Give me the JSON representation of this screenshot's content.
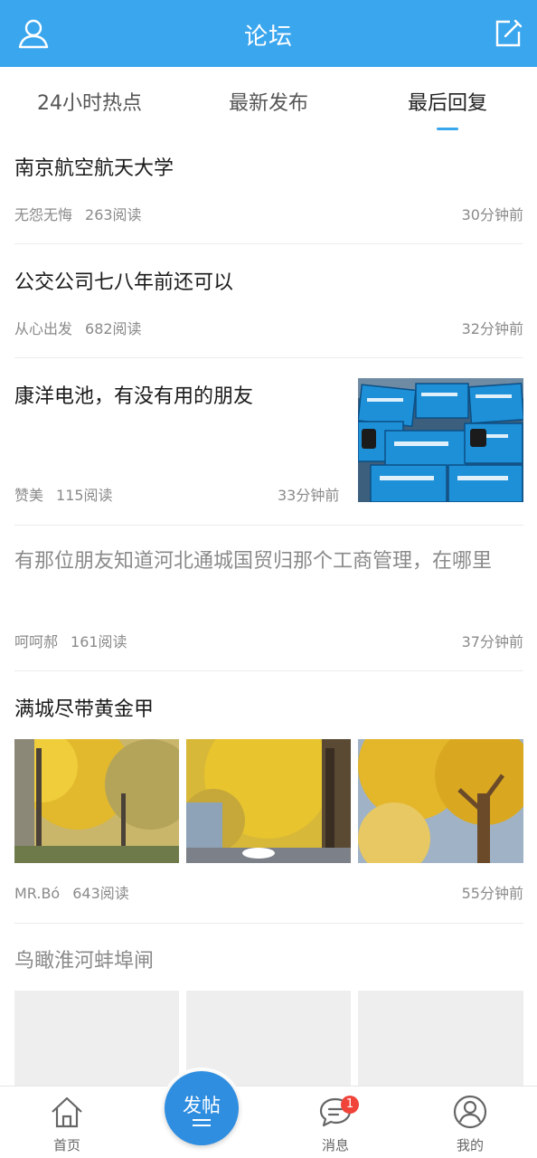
{
  "header": {
    "title": "论坛",
    "user_icon": "user-icon",
    "edit_icon": "edit-icon"
  },
  "tabs": [
    {
      "label": "24小时热点",
      "active": false
    },
    {
      "label": "最新发布",
      "active": false
    },
    {
      "label": "最后回复",
      "active": true
    }
  ],
  "posts": [
    {
      "title": "南京航空航天大学",
      "author": "无怨无悔",
      "reads": "263阅读",
      "time": "30分钟前"
    },
    {
      "title": "公交公司七八年前还可以",
      "author": "从心出发",
      "reads": "682阅读",
      "time": "32分钟前"
    },
    {
      "title": "康洋电池，有没有用的朋友",
      "author": "赞美",
      "reads": "115阅读",
      "time": "33分钟前"
    },
    {
      "title": "有那位朋友知道河北通城国贸归那个工商管理，在哪里",
      "author": "呵呵郝",
      "reads": "161阅读",
      "time": "37分钟前"
    },
    {
      "title": "满城尽带黄金甲",
      "author": "MR.Bó",
      "reads": "643阅读",
      "time": "55分钟前"
    },
    {
      "title": "鸟瞰淮河蚌埠闸"
    }
  ],
  "bottom_nav": {
    "home": {
      "label": "首页",
      "icon": "home-icon"
    },
    "post": {
      "label": "发帖",
      "icon": "compose-icon"
    },
    "messages": {
      "label": "消息",
      "icon": "message-icon",
      "badge": "1"
    },
    "mine": {
      "label": "我的",
      "icon": "profile-icon"
    }
  },
  "colors": {
    "accent": "#3aa6ee",
    "fab": "#2f8ee0",
    "badge": "#f0443a"
  }
}
